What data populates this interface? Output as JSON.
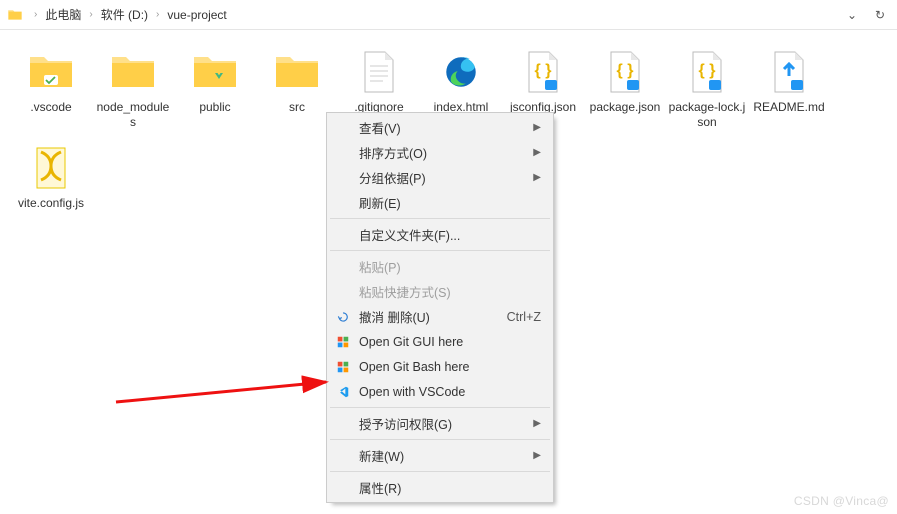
{
  "breadcrumb": {
    "items": [
      "此电脑",
      "软件 (D:)",
      "vue-project"
    ]
  },
  "files": [
    {
      "name": ".vscode",
      "type": "folder-vs"
    },
    {
      "name": "node_modules",
      "type": "folder"
    },
    {
      "name": "public",
      "type": "folder-vue"
    },
    {
      "name": "src",
      "type": "folder"
    },
    {
      "name": ".gitignore",
      "type": "text"
    },
    {
      "name": "index.html",
      "type": "edge"
    },
    {
      "name": "jsconfig.json",
      "type": "json"
    },
    {
      "name": "package.json",
      "type": "json"
    },
    {
      "name": "package-lock.json",
      "type": "json"
    },
    {
      "name": "README.md",
      "type": "md"
    },
    {
      "name": "vite.config.js",
      "type": "js"
    }
  ],
  "context_menu": {
    "groups": [
      [
        {
          "label": "查看(V)",
          "submenu": true
        },
        {
          "label": "排序方式(O)",
          "submenu": true
        },
        {
          "label": "分组依据(P)",
          "submenu": true
        },
        {
          "label": "刷新(E)"
        }
      ],
      [
        {
          "label": "自定义文件夹(F)..."
        }
      ],
      [
        {
          "label": "粘贴(P)",
          "disabled": true
        },
        {
          "label": "粘贴快捷方式(S)",
          "disabled": true
        },
        {
          "label": "撤消 删除(U)",
          "shortcut": "Ctrl+Z",
          "icon": "undo"
        },
        {
          "label": "Open Git GUI here",
          "icon": "git"
        },
        {
          "label": "Open Git Bash here",
          "icon": "git"
        },
        {
          "label": "Open with VSCode",
          "icon": "vscode"
        }
      ],
      [
        {
          "label": "授予访问权限(G)",
          "submenu": true
        }
      ],
      [
        {
          "label": "新建(W)",
          "submenu": true
        }
      ],
      [
        {
          "label": "属性(R)"
        }
      ]
    ]
  },
  "watermark": "CSDN @Vinca@"
}
